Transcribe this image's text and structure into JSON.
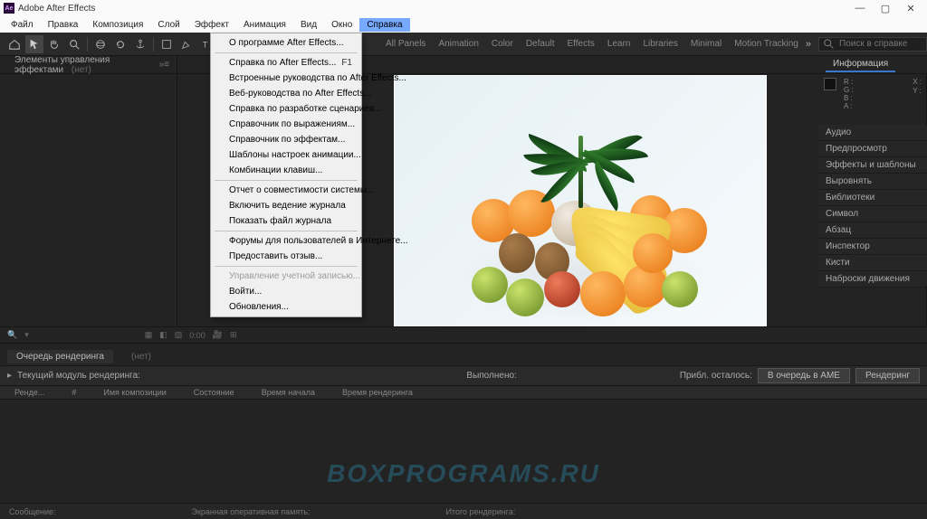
{
  "title": "Adobe After Effects",
  "menu": [
    "Файл",
    "Правка",
    "Композиция",
    "Слой",
    "Эффект",
    "Анимация",
    "Вид",
    "Окно",
    "Справка"
  ],
  "active_menu_index": 8,
  "help_menu": {
    "groups": [
      [
        {
          "label": "О программе After Effects..."
        }
      ],
      [
        {
          "label": "Справка по After Effects...",
          "shortcut": "F1"
        },
        {
          "label": "Встроенные руководства по After Effects..."
        },
        {
          "label": "Веб-руководства по After Effects..."
        },
        {
          "label": "Справка по разработке сценариев..."
        },
        {
          "label": "Справочник по выражениям..."
        },
        {
          "label": "Справочник по эффектам..."
        },
        {
          "label": "Шаблоны настроек анимации..."
        },
        {
          "label": "Комбинации клавиш..."
        }
      ],
      [
        {
          "label": "Отчет о совместимости системы..."
        },
        {
          "label": "Включить ведение журнала"
        },
        {
          "label": "Показать файл журнала"
        }
      ],
      [
        {
          "label": "Форумы для пользователей в Интернете..."
        },
        {
          "label": "Предоставить отзыв..."
        }
      ],
      [
        {
          "label": "Управление учетной записью...",
          "disabled": true
        },
        {
          "label": "Войти..."
        },
        {
          "label": "Обновления..."
        }
      ]
    ]
  },
  "workspaces": [
    "All Panels",
    "Animation",
    "Color",
    "Default",
    "Effects",
    "Learn",
    "Libraries",
    "Minimal",
    "Motion Tracking"
  ],
  "search_placeholder": "Поиск в справке",
  "left_panel": {
    "tab": "Элементы управления эффектами",
    "secondary": "(нет)"
  },
  "center_panel": {
    "tab_prefix": ""
  },
  "right": {
    "info_title": "Информация",
    "channels": [
      "R",
      "G",
      "B",
      "A"
    ],
    "x_label": "X :",
    "y_label": "Y :",
    "side_items": [
      "Аудио",
      "Предпросмотр",
      "Эффекты и шаблоны",
      "Выровнять",
      "Библиотеки",
      "Символ",
      "Абзац",
      "Инспектор",
      "Кисти",
      "Наброски движения"
    ]
  },
  "lower": {
    "tab_render": "Очередь рендеринга",
    "tab_none": "(нет)",
    "current_label": "Текущий модуль рендеринга:",
    "executed": "Выполнено:",
    "remaining": "Прибл. осталось:",
    "btn_queue": "В очередь в AME",
    "btn_render": "Рендеринг",
    "cols": [
      "Ренде...",
      "#",
      "Имя композиции",
      "Состояние",
      "Время начала",
      "Время рендеринга"
    ],
    "footer": [
      "Сообщение:",
      "Экранная оперативная память:",
      "Итого рендеринга:"
    ]
  },
  "watermark": "BOXPROGRAMS.RU"
}
